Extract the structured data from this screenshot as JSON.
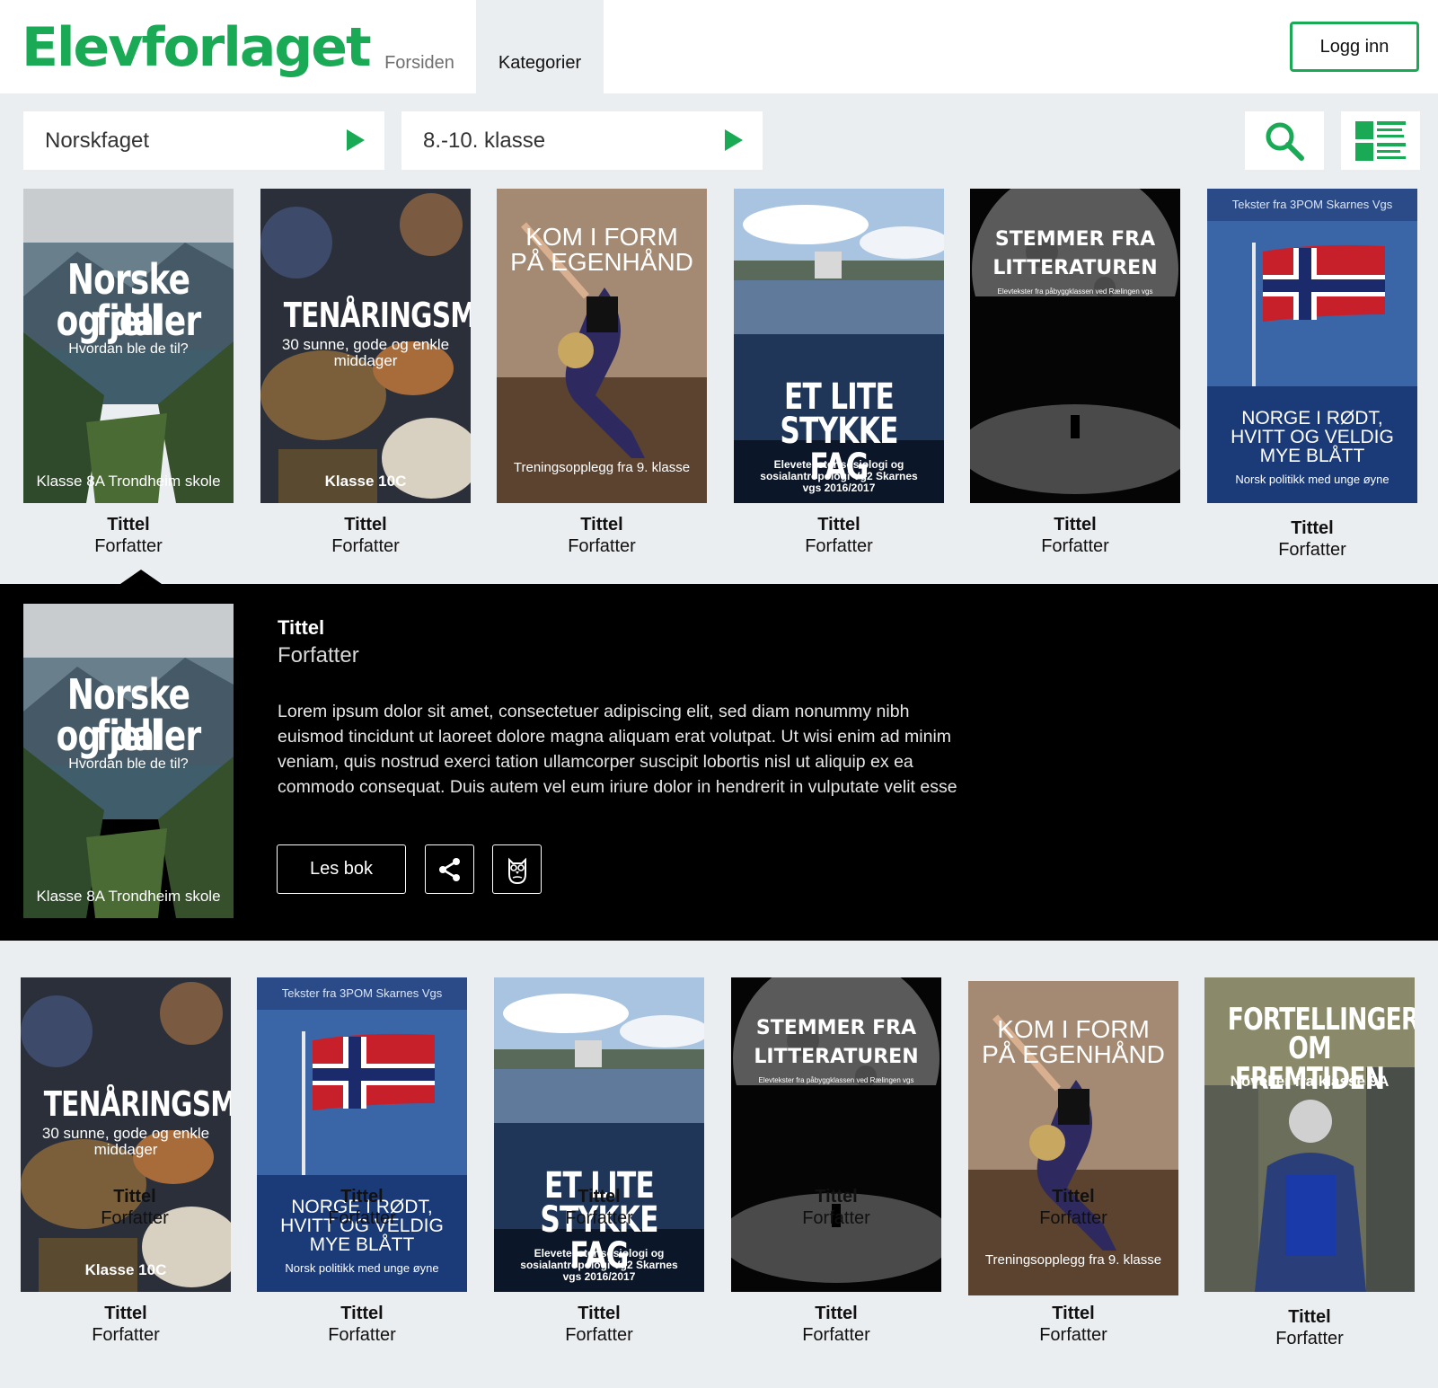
{
  "header": {
    "logo": "Elevforlaget",
    "nav": {
      "home": "Forsiden",
      "categories": "Kategorier"
    },
    "login_label": "Logg inn"
  },
  "filters": {
    "subject": "Norskfaget",
    "grade": "8.-10. klasse"
  },
  "icons": {
    "search": "search-icon",
    "list": "list-view-icon",
    "share": "share-icon",
    "owl": "owl-icon",
    "dropdown": "triangle-right-icon"
  },
  "colors": {
    "brand": "#1aaa55",
    "background": "#ebeef0",
    "panel": "#000000"
  },
  "covers": {
    "fjell": {
      "title_line1": "Norske fjell",
      "title_line2": "og daler",
      "subtitle": "Hvordan ble de til?",
      "footer": "Klasse 8A Trondheim skole"
    },
    "mat": {
      "title": "TENÅRINGSMAT",
      "subtitle_line1": "30 sunne, gode og enkle",
      "subtitle_line2": "middager",
      "footer": "Klasse 10C"
    },
    "form": {
      "title_line1": "KOM I FORM",
      "title_line2": "PÅ EGENHÅND",
      "footer": "Treningsopplegg fra 9. klasse"
    },
    "fag": {
      "title_line1": "ET LITE",
      "title_line2": "STYKKE FAG",
      "subtitle_line1": "Elevetekster sosiologi og",
      "subtitle_line2": "sosialantropologi Vg2 Skarnes",
      "subtitle_line3": "vgs 2016/2017"
    },
    "stemmer": {
      "title_line1": "STEMMER FRA",
      "title_line2": "LITTERATUREN",
      "subtitle": "Elevtekster fra påbyggklassen ved Rælingen vgs"
    },
    "norge": {
      "header": "Tekster fra 3POM Skarnes Vgs",
      "title_line1": "NORGE I RØDT,",
      "title_line2": "HVITT OG VELDIG",
      "title_line3": "MYE BLÅTT",
      "subtitle": "Norsk politikk med unge øyne"
    },
    "fremtiden": {
      "title_line1": "FORTELLINGER",
      "title_line2": "OM FREMTIDEN",
      "subtitle": "Noveller fra klasse 9A"
    }
  },
  "books_row1": [
    {
      "title": "Tittel",
      "author": "Forfatter"
    },
    {
      "title": "Tittel",
      "author": "Forfatter"
    },
    {
      "title": "Tittel",
      "author": "Forfatter"
    },
    {
      "title": "Tittel",
      "author": "Forfatter"
    },
    {
      "title": "Tittel",
      "author": "Forfatter"
    },
    {
      "title": "Tittel",
      "author": "Forfatter"
    }
  ],
  "books_row2": [
    {
      "title": "Tittel",
      "author": "Forfatter"
    },
    {
      "title": "Tittel",
      "author": "Forfatter"
    },
    {
      "title": "Tittel",
      "author": "Forfatter"
    },
    {
      "title": "Tittel",
      "author": "Forfatter"
    },
    {
      "title": "Tittel",
      "author": "Forfatter"
    },
    {
      "title": "Tittel",
      "author": "Forfatter"
    }
  ],
  "overlay_labels": [
    {
      "title": "Tittel",
      "author": "Forfatter"
    },
    {
      "title": "Tittel",
      "author": "Forfatter"
    },
    {
      "title": "Tittel",
      "author": "Forfatter"
    },
    {
      "title": "Tittel",
      "author": "Forfatter"
    },
    {
      "title": "Tittel",
      "author": "Forfatter"
    }
  ],
  "detail": {
    "title": "Tittel",
    "author": "Forfatter",
    "description": "Lorem ipsum dolor sit amet, consectetuer adipiscing elit, sed diam nonummy nibh euismod tincidunt ut laoreet dolore magna aliquam erat volutpat. Ut wisi enim ad minim veniam, quis nostrud exerci tation ullamcorper suscipit lobortis nisl ut aliquip ex ea commodo consequat. Duis autem vel eum iriure dolor in hendrerit in vulputate velit esse",
    "read_label": "Les bok"
  }
}
